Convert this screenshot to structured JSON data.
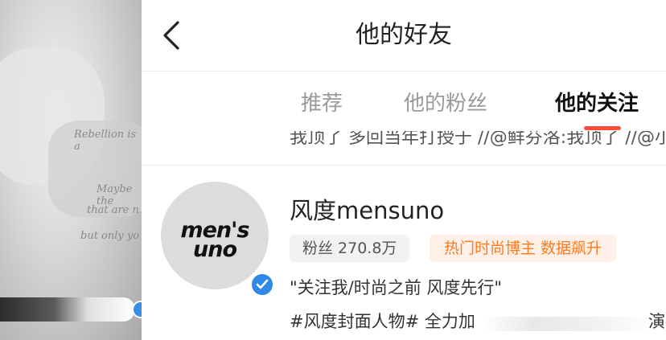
{
  "header": {
    "title": "他的好友"
  },
  "tabs": [
    {
      "label": "推荐",
      "active": false
    },
    {
      "label": "他的粉丝",
      "active": false
    },
    {
      "label": "他的关注",
      "active": true
    }
  ],
  "previous_item": {
    "text": "我顶了 多回当年打授于 //@鲜芬洛:我顶了 //@小"
  },
  "user": {
    "avatar_logo_line1": "men's",
    "avatar_logo_line2": "uno",
    "name": "风度mensuno",
    "fans_tag": "粉丝 270.8万",
    "hot_tag": "热门时尚博主 数据飙升",
    "bio": "\"关注我/时尚之前 风度先行\"",
    "desc": "#风度封面人物# 全力加",
    "desc_tail": "演",
    "verified": true
  },
  "background_panel": {
    "script_lines": [
      "Rebellion is a",
      "Maybe the",
      "that are n",
      "but only yo"
    ]
  },
  "colors": {
    "accent": "#ff4a3a",
    "verified": "#2f8ae6",
    "hot_tag_text": "#ff7a1f",
    "hot_tag_bg": "#fff1e8"
  },
  "icons": {
    "back": "chevron-left-icon",
    "verified": "verified-check-icon"
  }
}
